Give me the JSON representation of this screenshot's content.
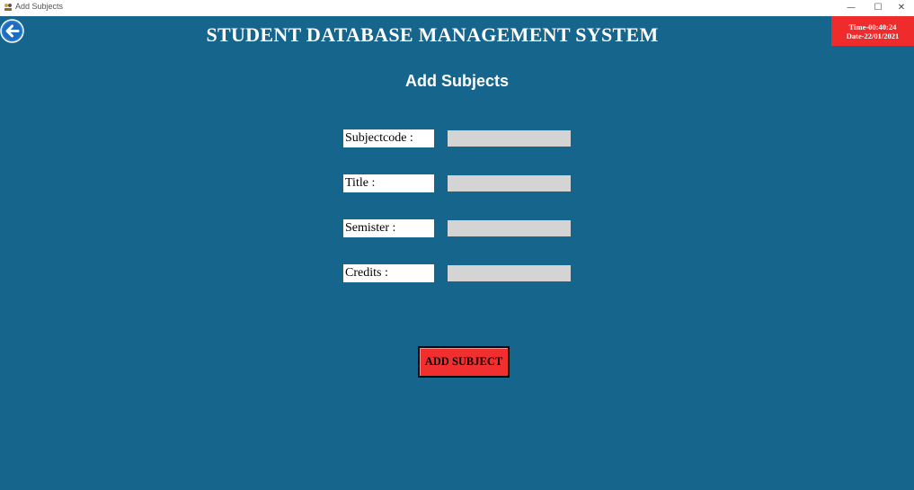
{
  "window": {
    "title": "Add Subjects",
    "minimize_glyph": "—",
    "maximize_glyph": "☐",
    "close_glyph": "✕"
  },
  "header": {
    "title": "STUDENT DATABASE MANAGEMENT SYSTEM",
    "time": "Time-00:40:24",
    "date": "Date-22/01/2021",
    "back_icon": "back-arrow-icon"
  },
  "page": {
    "title": "Add Subjects"
  },
  "form": {
    "fields": [
      {
        "label": "Subjectcode :",
        "value": ""
      },
      {
        "label": "Title :",
        "value": ""
      },
      {
        "label": "Semister :",
        "value": ""
      },
      {
        "label": "Credits :",
        "value": ""
      }
    ],
    "submit_label": "ADD SUBJECT"
  },
  "colors": {
    "background": "#16658c",
    "accent_red": "#f02b2b",
    "input_gray": "#d4d4d4"
  }
}
